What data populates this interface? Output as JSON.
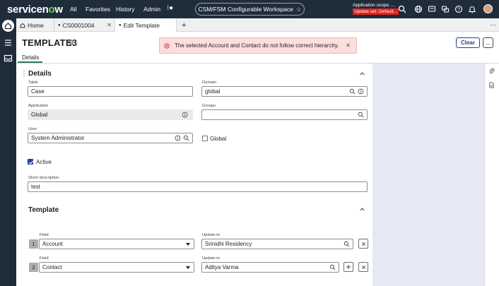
{
  "topnav": {
    "logo_prefix": "servicen",
    "logo_o": "o",
    "logo_suffix": "w",
    "links": [
      "All",
      "Favorites",
      "History",
      "Admin"
    ],
    "workspace_label": "CSM/FSM Configurable Workspace",
    "scope_label": "Application scope: ...",
    "update_set_label": "Update set: Default..."
  },
  "tabs": [
    {
      "label": "Home"
    },
    {
      "label": "CS0001004"
    },
    {
      "label": "Edit Template"
    }
  ],
  "header": {
    "title": "TEMPLATE3",
    "subtab": "Details",
    "alert_text": "The selected Account and Contact do not follow correct hierarchy.",
    "clear_label": "Clear",
    "more_label": "..."
  },
  "details": {
    "section_title": "Details",
    "table": {
      "label": "Table",
      "value": "Case"
    },
    "domain": {
      "label": "Domain",
      "value": "global"
    },
    "application": {
      "label": "Application",
      "value": "Global"
    },
    "groups": {
      "label": "Groups",
      "value": ""
    },
    "user": {
      "label": "User",
      "value": "System Administrator"
    },
    "global": {
      "label": "Global",
      "checked": false
    },
    "active": {
      "label": "Active",
      "checked": true
    },
    "short_description": {
      "label": "Short description",
      "value": "test"
    }
  },
  "template": {
    "section_title": "Template",
    "rows": [
      {
        "index": "1",
        "field_label": "Field",
        "field_value": "Account",
        "update_label": "Update to",
        "update_value": "Srinidhi Residency"
      },
      {
        "index": "2",
        "field_label": "Field",
        "field_value": "Contact",
        "update_label": "Update to",
        "update_value": "Aditya Varma"
      }
    ]
  },
  "colors": {
    "nav_bg": "#1f2c3a",
    "accent": "#293e8c",
    "alert_bg": "#fbdedd",
    "panel_bg": "#e6e9f5",
    "tab_underline": "#2d7a55"
  }
}
